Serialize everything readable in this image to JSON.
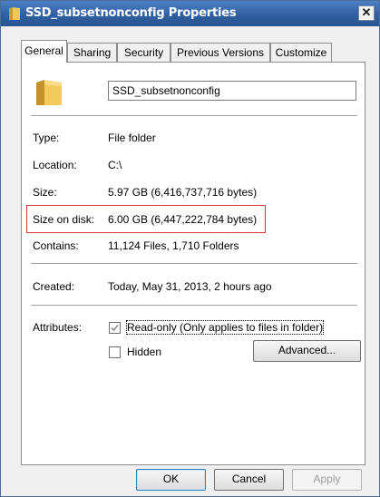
{
  "window": {
    "title": "SSD_subsetnonconfig Properties",
    "close_glyph": "✕"
  },
  "tabs": [
    {
      "label": "General",
      "active": true
    },
    {
      "label": "Sharing",
      "active": false
    },
    {
      "label": "Security",
      "active": false
    },
    {
      "label": "Previous Versions",
      "active": false
    },
    {
      "label": "Customize",
      "active": false
    }
  ],
  "general": {
    "folder_name": "SSD_subsetnonconfig",
    "icons": {
      "folder": "folder-icon",
      "title": "folder-icon"
    },
    "rows": {
      "type": {
        "label": "Type:",
        "value": "File folder"
      },
      "location": {
        "label": "Location:",
        "value": "C:\\"
      },
      "size": {
        "label": "Size:",
        "value": "5.97 GB (6,416,737,716 bytes)"
      },
      "size_on_disk": {
        "label": "Size on disk:",
        "value": "6.00 GB (6,447,222,784 bytes)"
      },
      "contains": {
        "label": "Contains:",
        "value": "11,124 Files, 1,710 Folders"
      },
      "created": {
        "label": "Created:",
        "value": "Today, May 31, 2013, 2 hours ago"
      }
    },
    "attributes": {
      "label": "Attributes:",
      "readonly": {
        "label": "Read-only (Only applies to files in folder)",
        "checked": "partial"
      },
      "hidden": {
        "label": "Hidden",
        "checked": false
      },
      "advanced_label": "Advanced..."
    },
    "highlight_color": "#d93b3b"
  },
  "buttons": {
    "ok": "OK",
    "cancel": "Cancel",
    "apply": "Apply"
  }
}
